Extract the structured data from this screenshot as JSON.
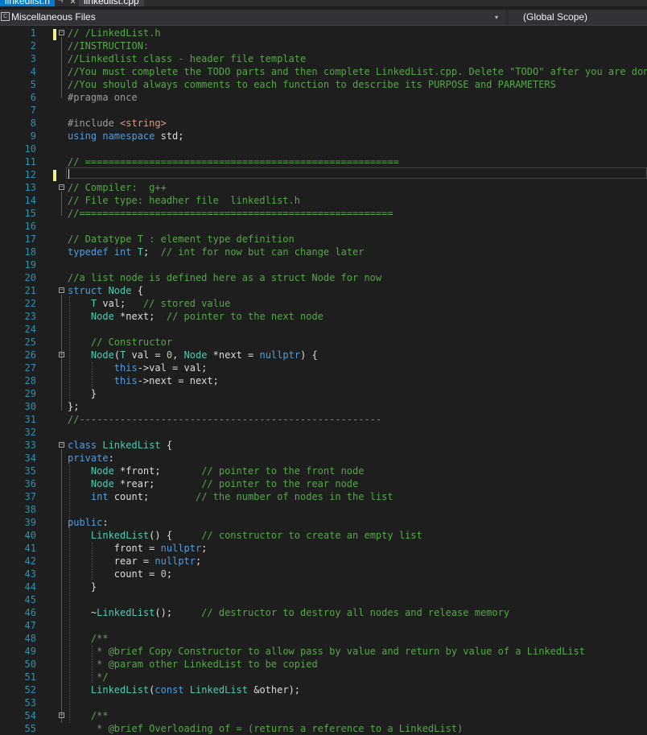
{
  "tabs": [
    {
      "label": "linkedlist.h",
      "active": true
    },
    {
      "label": "linkedlist.cpp",
      "active": false
    }
  ],
  "tab_icons": {
    "pin": "pin-icon",
    "close": "close-icon"
  },
  "navbar": {
    "project": "Miscellaneous Files",
    "scope": "(Global Scope)",
    "project_icon": "file-icon"
  },
  "colors": {
    "comment": "#57a64a",
    "keyword": "#569cd6",
    "type": "#4ec9b0",
    "string": "#d69d85",
    "number": "#b5cea8",
    "line_number": "#2b91af",
    "background": "#1e1e1e",
    "accent": "#007acc"
  },
  "editor": {
    "line_numbers": [
      "1",
      "2",
      "3",
      "4",
      "5",
      "6",
      "7",
      "8",
      "9",
      "10",
      "11",
      "12",
      "13",
      "14",
      "15",
      "16",
      "17",
      "18",
      "19",
      "20",
      "21",
      "22",
      "23",
      "24",
      "25",
      "26",
      "27",
      "28",
      "29",
      "30",
      "31",
      "32",
      "33",
      "34",
      "35",
      "36",
      "37",
      "38",
      "39",
      "40",
      "41",
      "42",
      "43",
      "44",
      "45",
      "46",
      "47",
      "48",
      "49",
      "50",
      "51",
      "52",
      "53",
      "54",
      "55"
    ],
    "lines": [
      [
        [
          "c",
          "// /LinkedList.h"
        ]
      ],
      [
        [
          "c",
          "//INSTRUCTION:"
        ]
      ],
      [
        [
          "c",
          "//Linkedlist class - header file template"
        ]
      ],
      [
        [
          "c",
          "//You must complete the TODO parts and then complete LinkedList.cpp. Delete \"TODO\" after you are done."
        ]
      ],
      [
        [
          "c",
          "//You should always comments to each function to describe its PURPOSE and PARAMETERS"
        ]
      ],
      [
        [
          "p",
          "#pragma once"
        ]
      ],
      [],
      [
        [
          "p",
          "#include "
        ],
        [
          "s",
          "<string>"
        ]
      ],
      [
        [
          "k",
          "using namespace "
        ],
        [
          "x",
          "std;"
        ]
      ],
      [],
      [
        [
          "c",
          "// ======================================================"
        ]
      ],
      [],
      [
        [
          "c",
          "// Compiler:  g++"
        ]
      ],
      [
        [
          "c",
          "// File type: headher file  linkedlist.h"
        ]
      ],
      [
        [
          "c",
          "//======================================================"
        ]
      ],
      [],
      [
        [
          "c",
          "// Datatype T : element type definition"
        ]
      ],
      [
        [
          "k",
          "typedef int "
        ],
        [
          "t",
          "T"
        ],
        [
          "x",
          ";  "
        ],
        [
          "c",
          "// int for now but can change later"
        ]
      ],
      [],
      [
        [
          "c",
          "//a list node is defined here as a struct Node for now"
        ]
      ],
      [
        [
          "k",
          "struct "
        ],
        [
          "t",
          "Node"
        ],
        [
          "x",
          " {"
        ]
      ],
      [
        [
          "x",
          "    "
        ],
        [
          "t",
          "T"
        ],
        [
          "x",
          " val;   "
        ],
        [
          "c",
          "// stored value"
        ]
      ],
      [
        [
          "x",
          "    "
        ],
        [
          "t",
          "Node"
        ],
        [
          "x",
          " *next;  "
        ],
        [
          "c",
          "// pointer to the next node"
        ]
      ],
      [],
      [
        [
          "x",
          "    "
        ],
        [
          "c",
          "// Constructor"
        ]
      ],
      [
        [
          "x",
          "    "
        ],
        [
          "t",
          "Node"
        ],
        [
          "x",
          "("
        ],
        [
          "t",
          "T"
        ],
        [
          "x",
          " val = "
        ],
        [
          "m",
          "0"
        ],
        [
          "x",
          ", "
        ],
        [
          "t",
          "Node"
        ],
        [
          "x",
          " *next = "
        ],
        [
          "k",
          "nullptr"
        ],
        [
          "x",
          ") {"
        ]
      ],
      [
        [
          "x",
          "        "
        ],
        [
          "k",
          "this"
        ],
        [
          "x",
          "->val = val;"
        ]
      ],
      [
        [
          "x",
          "        "
        ],
        [
          "k",
          "this"
        ],
        [
          "x",
          "->next = next;"
        ]
      ],
      [
        [
          "x",
          "    }"
        ]
      ],
      [
        [
          "x",
          "};"
        ]
      ],
      [
        [
          "c",
          "//----------------------------------------------------"
        ]
      ],
      [],
      [
        [
          "k",
          "class "
        ],
        [
          "t",
          "LinkedList"
        ],
        [
          "x",
          " {"
        ]
      ],
      [
        [
          "k",
          "private"
        ],
        [
          "x",
          ":"
        ]
      ],
      [
        [
          "x",
          "    "
        ],
        [
          "t",
          "Node"
        ],
        [
          "x",
          " *front;       "
        ],
        [
          "c",
          "// pointer to the front node"
        ]
      ],
      [
        [
          "x",
          "    "
        ],
        [
          "t",
          "Node"
        ],
        [
          "x",
          " *rear;        "
        ],
        [
          "c",
          "// pointer to the rear node"
        ]
      ],
      [
        [
          "x",
          "    "
        ],
        [
          "k",
          "int"
        ],
        [
          "x",
          " count;        "
        ],
        [
          "c",
          "// the number of nodes in the list"
        ]
      ],
      [],
      [
        [
          "k",
          "public"
        ],
        [
          "x",
          ":"
        ]
      ],
      [
        [
          "x",
          "    "
        ],
        [
          "t",
          "LinkedList"
        ],
        [
          "x",
          "() {     "
        ],
        [
          "c",
          "// constructor to create an empty list"
        ]
      ],
      [
        [
          "x",
          "        front = "
        ],
        [
          "k",
          "nullptr"
        ],
        [
          "x",
          ";"
        ]
      ],
      [
        [
          "x",
          "        rear = "
        ],
        [
          "k",
          "nullptr"
        ],
        [
          "x",
          ";"
        ]
      ],
      [
        [
          "x",
          "        count = "
        ],
        [
          "m",
          "0"
        ],
        [
          "x",
          ";"
        ]
      ],
      [
        [
          "x",
          "    }"
        ]
      ],
      [],
      [
        [
          "x",
          "    ~"
        ],
        [
          "t",
          "LinkedList"
        ],
        [
          "x",
          "();     "
        ],
        [
          "c",
          "// destructor to destroy all nodes and release memory"
        ]
      ],
      [],
      [
        [
          "x",
          "    "
        ],
        [
          "c",
          "/**"
        ]
      ],
      [
        [
          "x",
          "    "
        ],
        [
          "c",
          " * @brief Copy Constructor to allow pass by value and return by value of a LinkedList"
        ]
      ],
      [
        [
          "x",
          "    "
        ],
        [
          "c",
          " * @param other LinkedList to be copied"
        ]
      ],
      [
        [
          "x",
          "    "
        ],
        [
          "c",
          " */"
        ]
      ],
      [
        [
          "x",
          "    "
        ],
        [
          "t",
          "LinkedList"
        ],
        [
          "x",
          "("
        ],
        [
          "k",
          "const "
        ],
        [
          "t",
          "LinkedList"
        ],
        [
          "x",
          " &other);"
        ]
      ],
      [],
      [
        [
          "x",
          "    "
        ],
        [
          "c",
          "/**"
        ]
      ],
      [
        [
          "x",
          "    "
        ],
        [
          "c",
          " * @brief Overloading of = (returns a reference to a LinkedList)"
        ]
      ]
    ]
  }
}
